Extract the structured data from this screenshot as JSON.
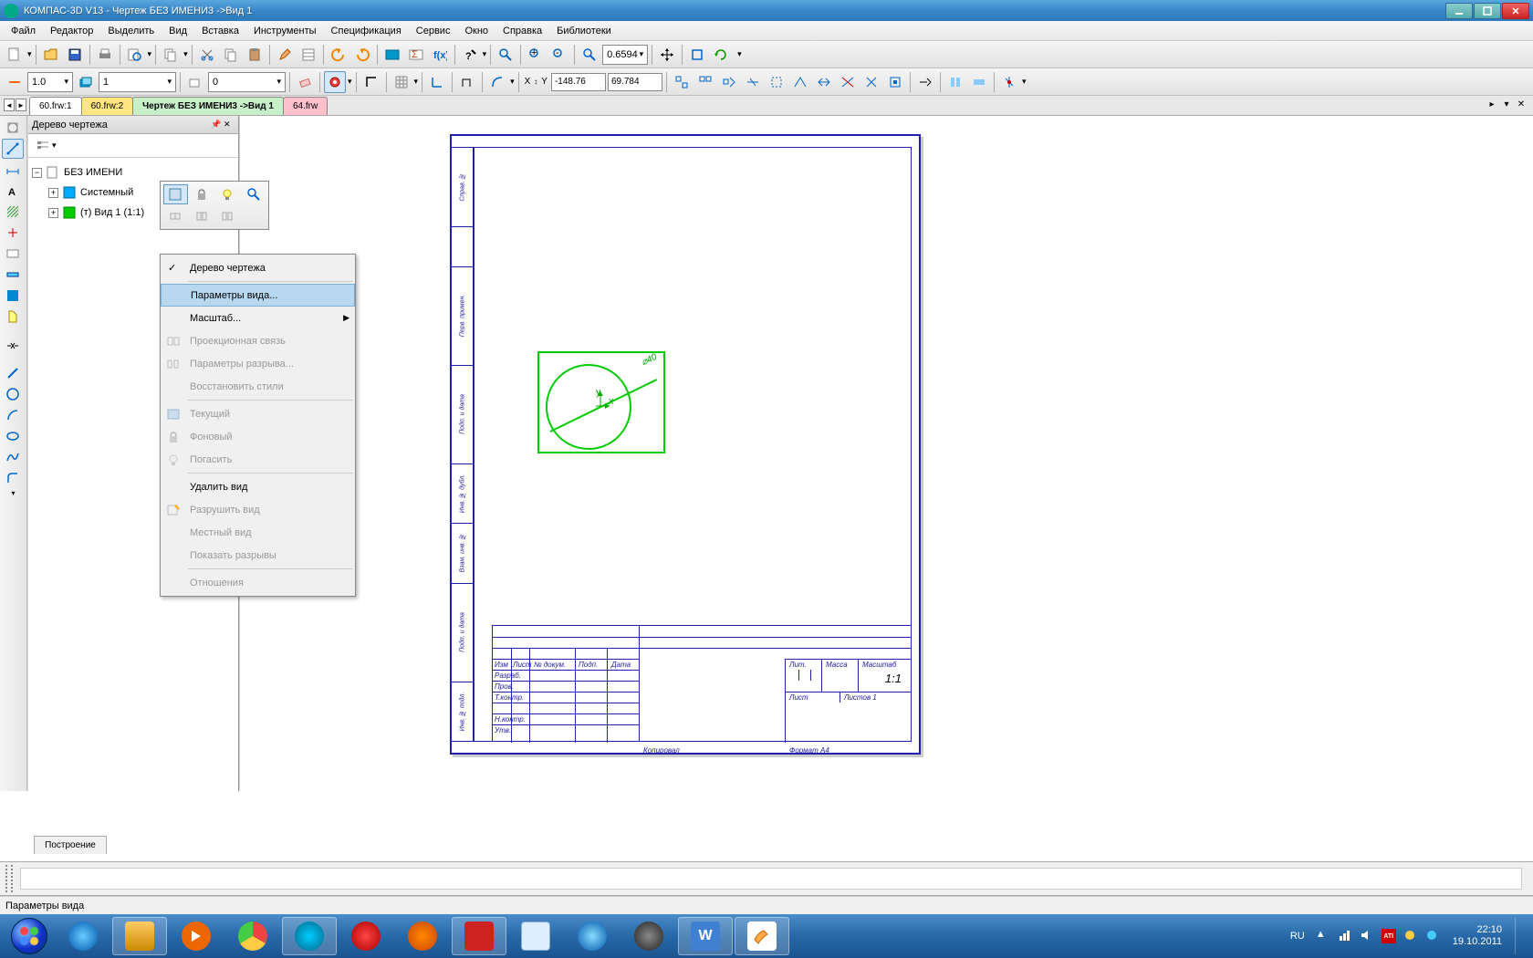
{
  "window": {
    "title": "КОМПАС-3D V13 - Чертеж БЕЗ ИМЕНИ3 ->Вид 1"
  },
  "menu": {
    "items": [
      "Файл",
      "Редактор",
      "Выделить",
      "Вид",
      "Вставка",
      "Инструменты",
      "Спецификация",
      "Сервис",
      "Окно",
      "Справка",
      "Библиотеки"
    ]
  },
  "toolbar2": {
    "thickness": "1.0",
    "step": "1",
    "val0": "0",
    "coordXlabel": "X",
    "coordYlabel": "Y",
    "coordX": "-148.76",
    "coordY": "69.784"
  },
  "zoom": "0.6594",
  "doctabs": {
    "t1": "60.frw:1",
    "t2": "60.frw:2",
    "t3": "Чертеж БЕЗ ИМЕНИ3 ->Вид 1",
    "t4": "64.frw"
  },
  "tree": {
    "title": "Дерево чертежа",
    "root": "БЕЗ ИМЕНИ",
    "n1": "Системный",
    "n2": "(т) Вид 1 (1:1)"
  },
  "ctx": {
    "i1": "Дерево чертежа",
    "i2": "Параметры вида...",
    "i3": "Масштаб...",
    "i4": "Проекционная связь",
    "i5": "Параметры разрыва...",
    "i6": "Восстановить стили",
    "i7": "Текущий",
    "i8": "Фоновый",
    "i9": "Погасить",
    "i10": "Удалить вид",
    "i11": "Разрушить вид",
    "i12": "Местный вид",
    "i13": "Показать разрывы",
    "i14": "Отношения"
  },
  "drawing": {
    "dimlabel": "⌀40",
    "scale": "1:1",
    "format": "Формат    A4",
    "kopiroval": "Копировал",
    "tb": {
      "lit": "Лит.",
      "mass": "Масса",
      "masht": "Масштаб",
      "izm": "Изм",
      "list": "Лист",
      "ndok": "№ докум.",
      "podp": "Подп.",
      "data": "Дата",
      "razrab": "Разраб.",
      "prov": "Пров.",
      "tkontr": "Т.контр.",
      "nkontr": "Н.контр.",
      "utb": "Утв.",
      "list2": "Лист",
      "listov": "Листов    1"
    }
  },
  "panel_bottom_tab": "Построение",
  "statusbar": "Параметры вида",
  "tray": {
    "lang": "RU",
    "time": "22:10",
    "date": "19.10.2011"
  }
}
